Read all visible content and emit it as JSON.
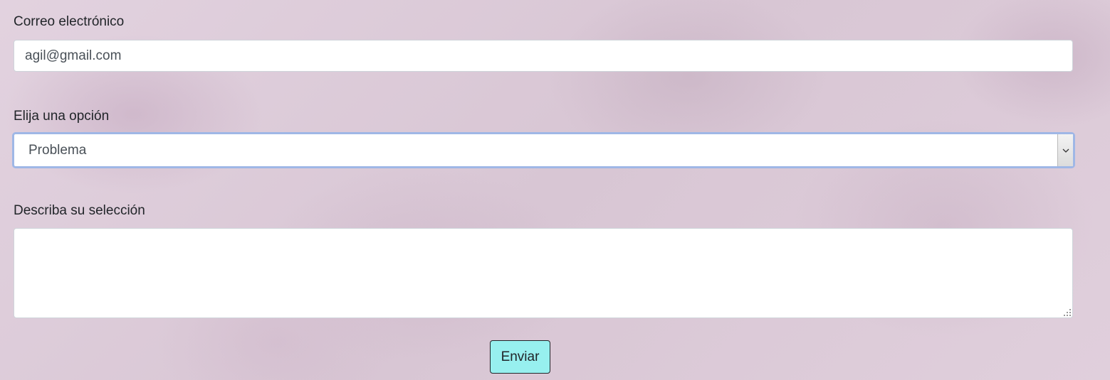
{
  "form": {
    "email": {
      "label": "Correo electrónico",
      "value": "agil@gmail.com"
    },
    "option": {
      "label": "Elija una opción",
      "selected": "Problema",
      "arrow_icon": "chevron-down-icon"
    },
    "description": {
      "label": "Describa su selección",
      "value": ""
    },
    "submit_label": "Enviar"
  },
  "colors": {
    "background": "#dccbd9",
    "submit_button": "#97f0ef",
    "focus_ring": "#9fb7e6"
  }
}
